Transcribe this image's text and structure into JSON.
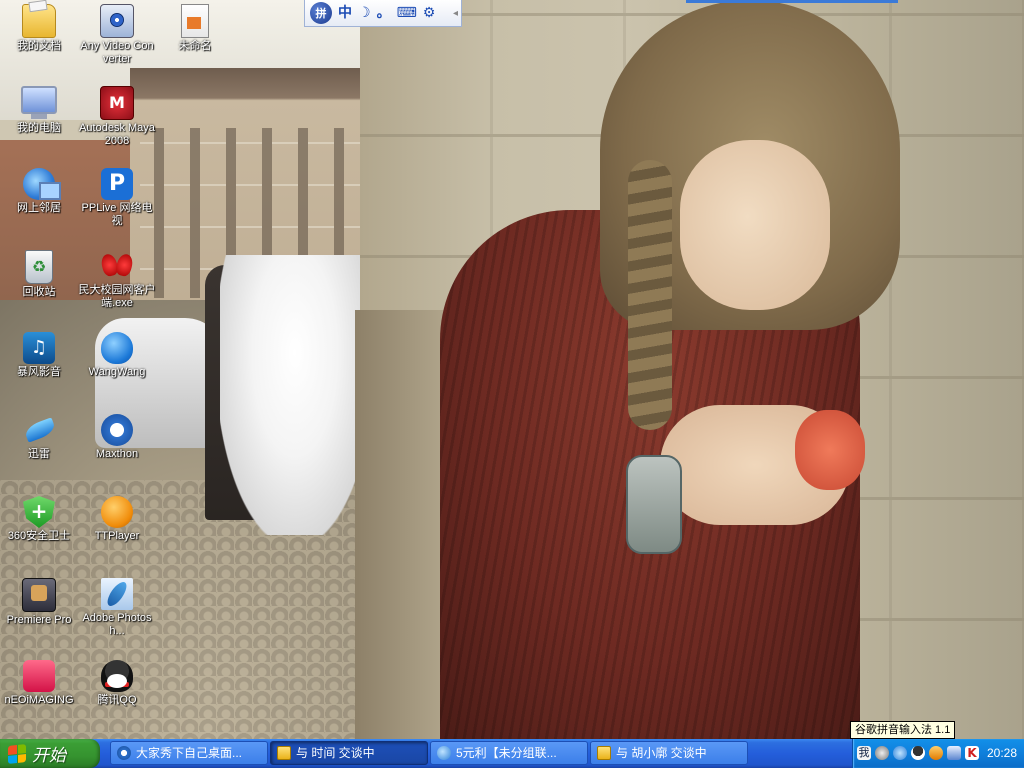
{
  "desktop": {
    "icons": [
      {
        "id": "my-documents",
        "label": "我的文档"
      },
      {
        "id": "any-video-converter",
        "label": "Any Video Converter"
      },
      {
        "id": "untitled",
        "label": "未命名"
      },
      {
        "id": "my-computer",
        "label": "我的电脑"
      },
      {
        "id": "autodesk-maya",
        "label": "Autodesk Maya 2008"
      },
      {
        "id": "network-places",
        "label": "网上邻居"
      },
      {
        "id": "pplive",
        "label": "PPLive 网络电视"
      },
      {
        "id": "recycle-bin",
        "label": "回收站"
      },
      {
        "id": "campus-client",
        "label": "民大校园网客户端.exe"
      },
      {
        "id": "baofeng",
        "label": "暴风影音"
      },
      {
        "id": "wangwang",
        "label": "WangWang"
      },
      {
        "id": "xunlei",
        "label": "迅雷"
      },
      {
        "id": "maxthon",
        "label": "Maxthon"
      },
      {
        "id": "360-safe",
        "label": "360安全卫士"
      },
      {
        "id": "ttplayer",
        "label": "TTPlayer"
      },
      {
        "id": "premiere-pro",
        "label": "Premiere Pro"
      },
      {
        "id": "adobe-photoshop",
        "label": "Adobe Photosh..."
      },
      {
        "id": "neoimaging",
        "label": "nEOiMAGING"
      },
      {
        "id": "tencent-qq",
        "label": "腾讯QQ"
      }
    ]
  },
  "ime_toolbar": {
    "logo": "拼",
    "mode": "中",
    "punct": "。",
    "arrow": "◂"
  },
  "ime_tooltip": "谷歌拼音输入法 1.1",
  "taskbar": {
    "start_label": "开始",
    "tasks": [
      {
        "label": "大家秀下自己桌面...",
        "icon": "maxthon-icon",
        "active": false
      },
      {
        "label": "与 时间 交谈中",
        "icon": "chat-icon",
        "active": true
      },
      {
        "label": "5元利【未分组联...",
        "icon": "ie-icon",
        "active": false
      },
      {
        "label": "与 胡小廓 交谈中",
        "icon": "chat-icon",
        "active": false
      }
    ],
    "tray": {
      "ime_indicator": "我",
      "clock": "20:28"
    }
  },
  "colors": {
    "taskbar_blue": "#245edb",
    "start_green": "#35932f",
    "tray_blue": "#0f7fdb"
  }
}
